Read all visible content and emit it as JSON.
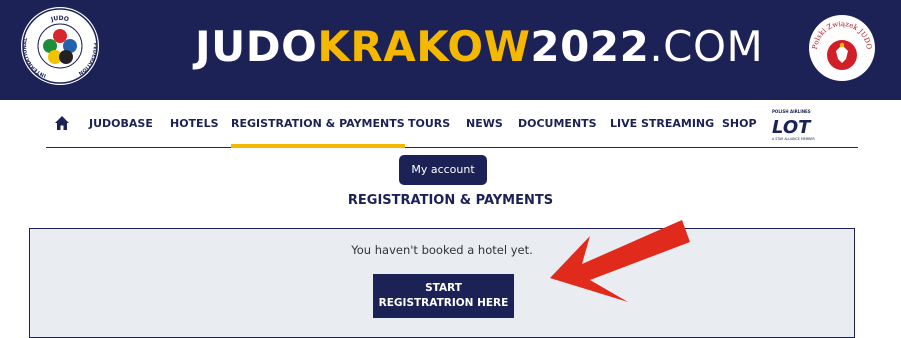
{
  "header": {
    "title_part1": "JUDO",
    "title_part2": "KRAKOW",
    "title_part3": "2022",
    "title_part4": ".COM",
    "ijf_logo_text_top": "JUDO",
    "ijf_logo_text_left": "INTERNATIONAL",
    "ijf_logo_text_right": "FEDERATION",
    "pzj_logo_text": "Polski Związek JUDO",
    "background_color": "#1c2255",
    "accent_color": "#f5b800"
  },
  "nav": {
    "home_icon": "home-icon",
    "items": [
      {
        "label": "JUDOBASE"
      },
      {
        "label": "HOTELS"
      },
      {
        "label": "REGISTRATION & PAYMENTS",
        "active": true
      },
      {
        "label": "TOURS"
      },
      {
        "label": "NEWS"
      },
      {
        "label": "DOCUMENTS"
      },
      {
        "label": "LIVE STREAMING"
      },
      {
        "label": "SHOP"
      }
    ],
    "sponsor": {
      "top_text": "POLISH AIRLINES",
      "logo_text": "LOT",
      "bottom_text": "A STAR ALLIANCE MEMBER"
    }
  },
  "main": {
    "account_button": "My account",
    "heading": "REGISTRATION & PAYMENTS",
    "notice": "You haven't booked a hotel yet.",
    "start_button_line1": "START",
    "start_button_line2": "REGISTRATRION HERE"
  },
  "annotation": {
    "arrow_color": "#e02b1c"
  }
}
